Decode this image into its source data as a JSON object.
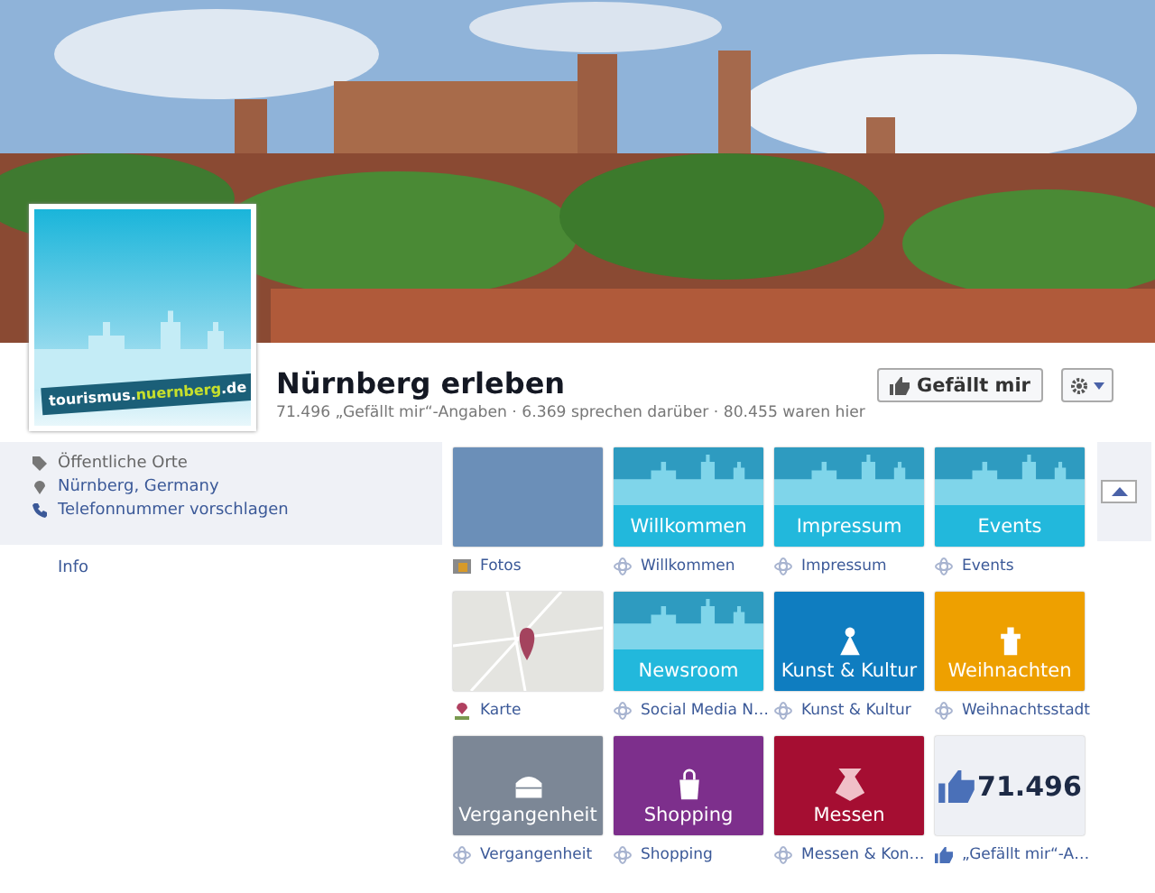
{
  "page": {
    "name": "Nürnberg erleben",
    "stats": "71.496 „Gefällt mir“-Angaben · 6.369 sprechen darüber · 80.455 waren hier",
    "logo": {
      "prefix": "tourismus.",
      "highlight": "nuernberg",
      "suffix": ".de"
    }
  },
  "actions": {
    "like": "Gefällt mir"
  },
  "about": [
    {
      "kind": "category",
      "text": "Öffentliche Orte"
    },
    {
      "kind": "location",
      "text": "Nürnberg, Germany"
    },
    {
      "kind": "phone",
      "text": "Telefonnummer vorschlagen"
    }
  ],
  "info_link": "Info",
  "tiles": [
    {
      "kind": "photo",
      "label": "Fotos",
      "color": "#6b8fb8"
    },
    {
      "kind": "skyline",
      "title": "Willkommen",
      "label": "Willkommen",
      "color": "#22b8dc"
    },
    {
      "kind": "skyline",
      "title": "Impressum",
      "label": "Impressum",
      "color": "#22b8dc"
    },
    {
      "kind": "skyline",
      "title": "Events",
      "label": "Events",
      "color": "#22b8dc"
    },
    {
      "kind": "map",
      "label": "Karte",
      "color": "#e4e4e0"
    },
    {
      "kind": "skyline",
      "title": "Newsroom",
      "label": "Social Media N…",
      "color": "#22b8dc"
    },
    {
      "kind": "culture",
      "title": "Kunst & Kultur",
      "label": "Kunst & Kultur",
      "color": "#0f7dc0"
    },
    {
      "kind": "christmas",
      "title": "Weihnachten",
      "label": "Weihnachtsstadt",
      "color": "#eea000"
    },
    {
      "kind": "history",
      "title": "Vergangenheit",
      "label": "Vergangenheit",
      "color": "#7c8796"
    },
    {
      "kind": "shopping",
      "title": "Shopping",
      "label": "Shopping",
      "color": "#7d2f8c"
    },
    {
      "kind": "fair",
      "title": "Messen",
      "label": "Messen & Kon…",
      "color": "#a50e32"
    },
    {
      "kind": "likes",
      "title": "71.496",
      "label": "„Gefällt mir“-A…",
      "color": "#eef0f5"
    }
  ]
}
